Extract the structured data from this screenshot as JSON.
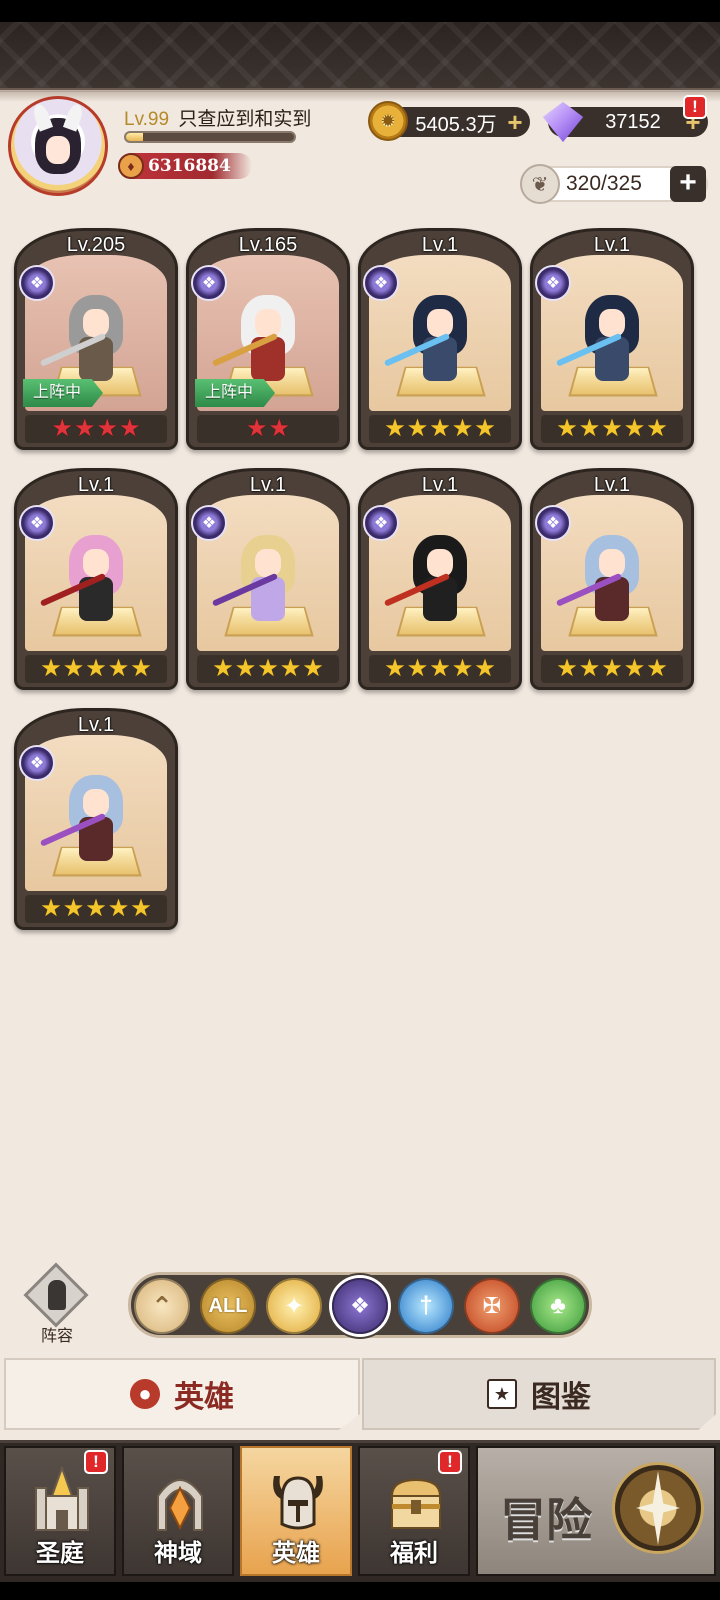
{
  "player": {
    "level": "Lv.99",
    "name": "只查应到和实到",
    "exp_progress": 0.1,
    "power": "6316884"
  },
  "resources": {
    "gold": "5405.3万",
    "gems": "37152",
    "gems_alert": "!",
    "stamina": "320/325"
  },
  "heroes": [
    {
      "level": "Lv.205",
      "stars": 4,
      "star_color": "red",
      "deployed": true,
      "deploy_label": "上阵中"
    },
    {
      "level": "Lv.165",
      "stars": 2,
      "star_color": "red",
      "deployed": true,
      "deploy_label": "上阵中"
    },
    {
      "level": "Lv.1",
      "stars": 5,
      "star_color": "gold",
      "deployed": false
    },
    {
      "level": "Lv.1",
      "stars": 5,
      "star_color": "gold",
      "deployed": false
    },
    {
      "level": "Lv.1",
      "stars": 5,
      "star_color": "gold",
      "deployed": false
    },
    {
      "level": "Lv.1",
      "stars": 5,
      "star_color": "gold",
      "deployed": false
    },
    {
      "level": "Lv.1",
      "stars": 5,
      "star_color": "gold",
      "deployed": false
    },
    {
      "level": "Lv.1",
      "stars": 5,
      "star_color": "gold",
      "deployed": false
    },
    {
      "level": "Lv.1",
      "stars": 5,
      "star_color": "gold",
      "deployed": false
    }
  ],
  "filters": {
    "lineup_label": "阵容",
    "all_label": "ALL",
    "items": [
      "collapse",
      "all",
      "light",
      "dark",
      "order",
      "beast",
      "nature"
    ],
    "selected": "dark"
  },
  "tabs": {
    "heroes": "英雄",
    "album": "图鉴"
  },
  "bottom_nav": {
    "items": [
      {
        "label": "圣庭",
        "alert": "!"
      },
      {
        "label": "神域",
        "alert": ""
      },
      {
        "label": "英雄",
        "alert": ""
      },
      {
        "label": "福利",
        "alert": "!"
      }
    ],
    "adventure": "冒险"
  }
}
